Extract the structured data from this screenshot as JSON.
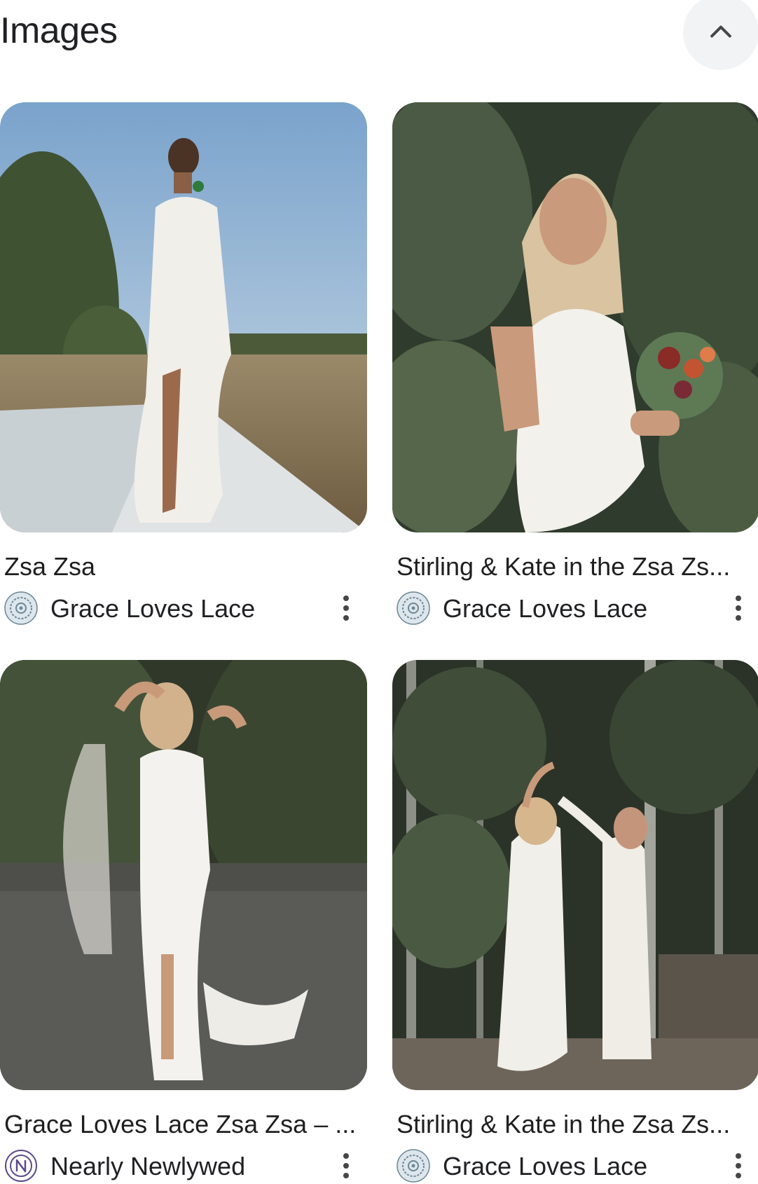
{
  "header": {
    "title": "Images",
    "collapse_icon": "chevron-up-icon"
  },
  "results": [
    {
      "title": "Zsa Zsa",
      "source": "Grace Loves Lace",
      "source_icon": "grace-loves-lace-logo",
      "more_icon": "more-vert-icon"
    },
    {
      "title": "Stirling & Kate in the Zsa Zs...",
      "source": "Grace Loves Lace",
      "source_icon": "grace-loves-lace-logo",
      "more_icon": "more-vert-icon"
    },
    {
      "title": "Grace Loves Lace Zsa Zsa – ...",
      "source": "Nearly Newlywed",
      "source_icon": "nearly-newlywed-logo",
      "more_icon": "more-vert-icon"
    },
    {
      "title": "Stirling & Kate in the Zsa Zs...",
      "source": "Grace Loves Lace",
      "source_icon": "grace-loves-lace-logo",
      "more_icon": "more-vert-icon"
    }
  ],
  "colors": {
    "collapse_button_bg": "#f1f3f4",
    "text_primary": "#1f1f1f",
    "icon_gray": "#5f6368"
  }
}
